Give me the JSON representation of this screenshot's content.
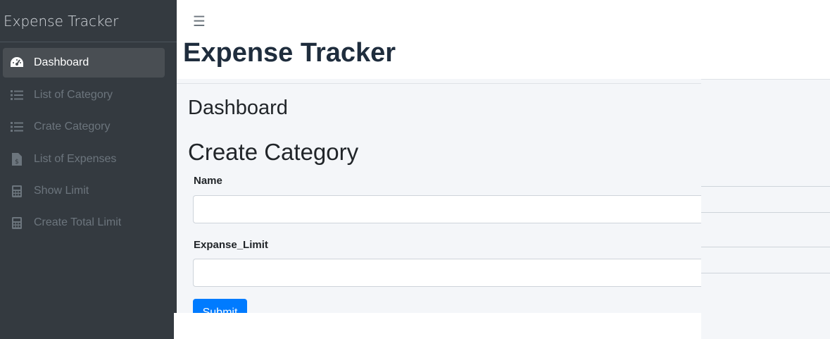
{
  "brand": {
    "title": "Expense Tracker"
  },
  "sidebar": {
    "items": [
      {
        "label": "Dashboard",
        "icon": "dashboard-gauge-icon",
        "active": true
      },
      {
        "label": "List of Category",
        "icon": "list-icon",
        "active": false
      },
      {
        "label": "Crate Category",
        "icon": "list-icon",
        "active": false
      },
      {
        "label": "List of Expenses",
        "icon": "file-invoice-icon",
        "active": false
      },
      {
        "label": "Show Limit",
        "icon": "calculator-icon",
        "active": false
      },
      {
        "label": "Create Total Limit",
        "icon": "calculator-icon",
        "active": false
      }
    ]
  },
  "header": {
    "menu_icon": "hamburger-menu-icon",
    "title": "Expense Tracker"
  },
  "main": {
    "breadcrumb_title": "Dashboard",
    "page_title": "Create Category",
    "form": {
      "name_label": "Name",
      "name_value": "",
      "limit_label": "Expanse_Limit",
      "limit_value": "",
      "submit_label": "Submit"
    }
  },
  "colors": {
    "sidebar_bg": "#343a40",
    "active_item_bg": "#494e53",
    "primary": "#007bff",
    "content_bg": "#f4f6f9"
  }
}
